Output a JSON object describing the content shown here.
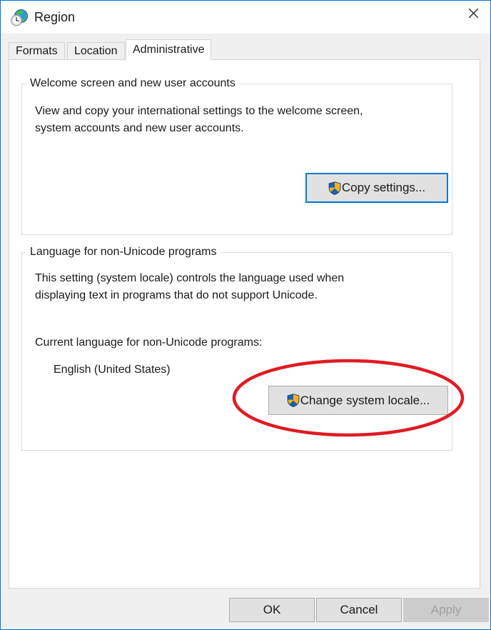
{
  "window": {
    "title": "Region",
    "icon": "region-globe-clock-icon",
    "close_label": "✕",
    "border_color": "#0078d7"
  },
  "tabs": [
    {
      "label": "Formats",
      "selected": false
    },
    {
      "label": "Location",
      "selected": false
    },
    {
      "label": "Administrative",
      "selected": true
    }
  ],
  "groups": [
    {
      "title": "Welcome screen and new user accounts",
      "lines": [
        "View and copy your international settings to the welcome screen,",
        "system accounts and new user accounts."
      ],
      "button": {
        "label": "Copy settings...",
        "icon": "uac-shield-icon",
        "focused": true
      }
    },
    {
      "title": "Language for non-Unicode programs",
      "lines": [
        "This setting (system locale) controls the language used when",
        "displaying text in programs that do not support Unicode."
      ],
      "current_label": "Current language for non-Unicode programs:",
      "current_value": "English (United States)",
      "button": {
        "label": "Change system locale...",
        "icon": "uac-shield-icon",
        "focused": false
      }
    }
  ],
  "footer": {
    "ok_label": "OK",
    "cancel_label": "Cancel",
    "apply_label": "Apply",
    "apply_disabled": true
  },
  "annotation": {
    "shape": "ellipse",
    "color": "#e01b24",
    "target": "Change system locale..."
  }
}
